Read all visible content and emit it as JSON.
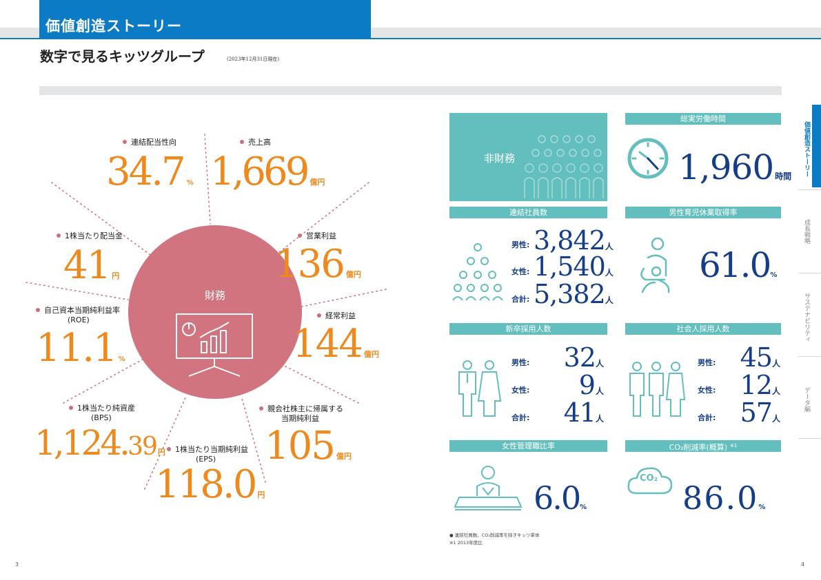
{
  "header": {
    "section_title": "価値創造ストーリー",
    "page_title": "数字で見るキッツグループ",
    "date_note": "(2023年12月31日現在)"
  },
  "financial": {
    "center_label": "財務",
    "metrics": [
      {
        "label": "連結配当性向",
        "value": "34.7",
        "unit": "%"
      },
      {
        "label": "売上高",
        "value": "1,669",
        "unit": "億円"
      },
      {
        "label": "1株当たり配当金",
        "value": "41",
        "unit": "円"
      },
      {
        "label": "営業利益",
        "value": "136",
        "unit": "億円"
      },
      {
        "label1": "自己資本当期純利益率",
        "label2": "(ROE)",
        "value": "11.1",
        "unit": "%"
      },
      {
        "label": "経常利益",
        "value": "144",
        "unit": "億円"
      },
      {
        "label1": "1株当たり純資産",
        "label2": "(BPS)",
        "value_main": "1,124.",
        "value_dec": "39",
        "unit": "円"
      },
      {
        "label1": "1株当たり当期純利益",
        "label2": "(EPS)",
        "value": "118.0",
        "unit": "円"
      },
      {
        "label1": "親会社株主に帰属する",
        "label2": "当期純利益",
        "value": "105",
        "unit": "億円"
      }
    ]
  },
  "nonfinancial": {
    "label": "非財務",
    "work_hours": {
      "title": "総実労働時間",
      "value": "1,960",
      "unit": "時間"
    },
    "employees": {
      "title": "連結社員数",
      "rows": [
        {
          "label": "男性:",
          "value": "3,842",
          "unit": "人"
        },
        {
          "label": "女性:",
          "value": "1,540",
          "unit": "人"
        },
        {
          "label": "合計:",
          "value": "5,382",
          "unit": "人"
        }
      ]
    },
    "paternity": {
      "title": "男性育児休業取得率",
      "value": "61.0",
      "unit": "%"
    },
    "new_grad": {
      "title": "新卒採用人数",
      "rows": [
        {
          "label": "男性:",
          "value": "32",
          "unit": "人"
        },
        {
          "label": "女性:",
          "value": "9",
          "unit": "人"
        },
        {
          "label": "合計:",
          "value": "41",
          "unit": "人"
        }
      ]
    },
    "mid_career": {
      "title": "社会人採用人数",
      "rows": [
        {
          "label": "男性:",
          "value": "45",
          "unit": "人"
        },
        {
          "label": "女性:",
          "value": "12",
          "unit": "人"
        },
        {
          "label": "合計:",
          "value": "57",
          "unit": "人"
        }
      ]
    },
    "female_mgr": {
      "title": "女性管理職比率",
      "value": "6.0",
      "unit": "%"
    },
    "co2": {
      "title": "CO₂削減率(概算)",
      "note_mark": "※1",
      "icon_text": "CO₂",
      "value": "86.0",
      "unit": "%"
    }
  },
  "footnotes": {
    "line1": "● 連結社員数、CO₂削減率を除きキッツ単体",
    "line2": "※1 2013年度比"
  },
  "side_nav": [
    {
      "label": "価値創造ストーリー",
      "active": true
    },
    {
      "label": "成長戦略",
      "active": false
    },
    {
      "label": "サステナビリティ",
      "active": false
    },
    {
      "label": "データ編",
      "active": false
    }
  ],
  "page_numbers": {
    "left": "3",
    "right": "4"
  },
  "colors": {
    "blue": "#0a7bc4",
    "orange": "#ee8a1d",
    "pink": "#d1747f",
    "teal": "#62bfbd",
    "navy": "#163e88"
  }
}
